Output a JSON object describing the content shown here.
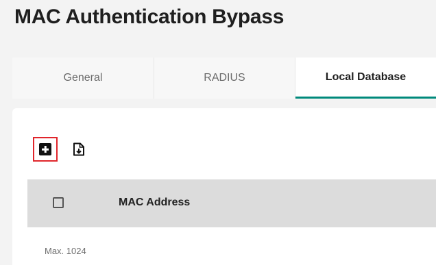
{
  "page": {
    "title": "MAC Authentication Bypass"
  },
  "tabs": [
    {
      "label": "General",
      "active": false
    },
    {
      "label": "RADIUS",
      "active": false
    },
    {
      "label": "Local Database",
      "active": true
    }
  ],
  "toolbar": {
    "add_icon": "add-square-icon",
    "import_icon": "file-import-icon"
  },
  "table": {
    "columns": [
      "MAC Address"
    ],
    "select_all_checked": false
  },
  "footer": {
    "max_note": "Max. 1024"
  },
  "colors": {
    "active_tab_underline": "#00897b",
    "highlight_border": "#e0252b",
    "table_header_bg": "#dcdcdc"
  }
}
